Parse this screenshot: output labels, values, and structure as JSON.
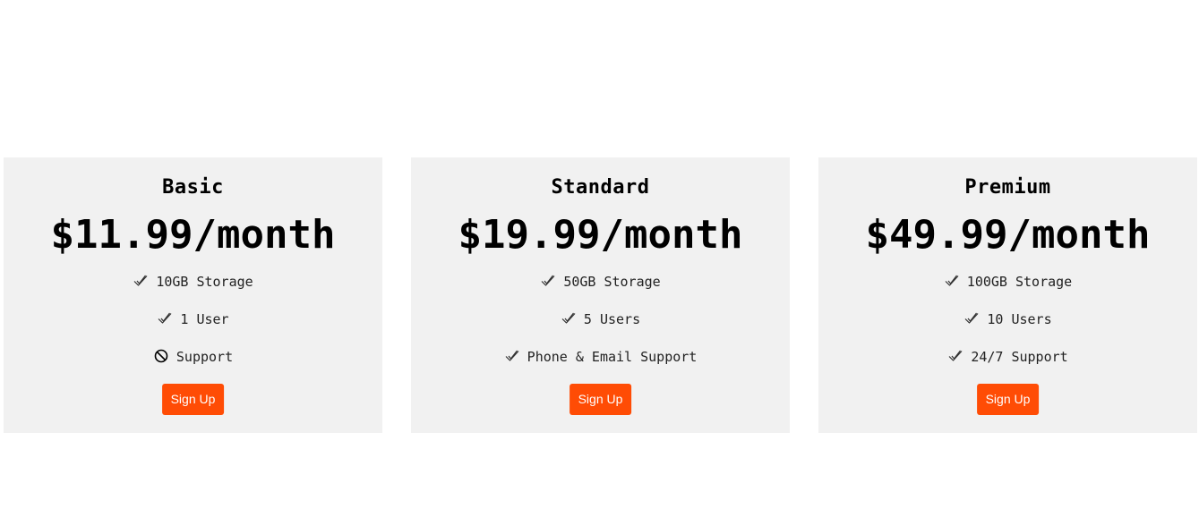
{
  "plans": [
    {
      "name": "Basic",
      "price": "$11.99/month",
      "features": [
        {
          "icon": "check-icon",
          "text": "10GB Storage"
        },
        {
          "icon": "check-icon",
          "text": "1 User"
        },
        {
          "icon": "no-icon",
          "text": "Support"
        }
      ],
      "button": "Sign Up"
    },
    {
      "name": "Standard",
      "price": "$19.99/month",
      "features": [
        {
          "icon": "check-icon",
          "text": "50GB Storage"
        },
        {
          "icon": "check-icon",
          "text": "5 Users"
        },
        {
          "icon": "check-icon",
          "text": "Phone & Email Support"
        }
      ],
      "button": "Sign Up"
    },
    {
      "name": "Premium",
      "price": "$49.99/month",
      "features": [
        {
          "icon": "check-icon",
          "text": "100GB Storage"
        },
        {
          "icon": "check-icon",
          "text": "10 Users"
        },
        {
          "icon": "check-icon",
          "text": "24/7 Support"
        }
      ],
      "button": "Sign Up"
    }
  ],
  "colors": {
    "card_background": "#f1f1f1",
    "button_background": "#ff4c05",
    "button_text": "#ffffff",
    "page_background": "#ffffff"
  }
}
